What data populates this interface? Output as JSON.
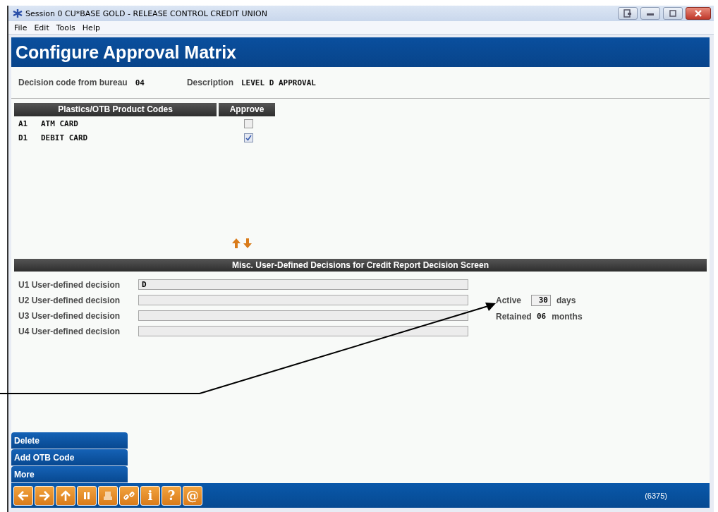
{
  "window": {
    "title": "Session 0 CU*BASE GOLD - RELEASE CONTROL CREDIT UNION"
  },
  "menu": [
    "File",
    "Edit",
    "Tools",
    "Help"
  ],
  "header": {
    "title": "Configure Approval Matrix"
  },
  "decision": {
    "label": "Decision code from bureau",
    "value": "04",
    "description_label": "Description",
    "description": "LEVEL D APPROVAL"
  },
  "products": {
    "columns": [
      "Plastics/OTB Product Codes",
      "Approve"
    ],
    "rows": [
      {
        "code": "A1",
        "name": "ATM CARD",
        "approve": false
      },
      {
        "code": "D1",
        "name": "DEBIT CARD",
        "approve": true
      }
    ]
  },
  "misc": {
    "title": "Misc. User-Defined Decisions for Credit Report Decision Screen",
    "decisions": [
      {
        "label": "U1 User-defined decision",
        "value": "D"
      },
      {
        "label": "U2 User-defined decision"
      },
      {
        "label": "U3 User-defined decision"
      },
      {
        "label": "U4 User-defined decision"
      }
    ],
    "active": {
      "label": "Active",
      "value": "30",
      "unit": "days"
    },
    "retained": {
      "label": "Retained",
      "value": "06",
      "unit": "months"
    }
  },
  "actions": [
    "Delete",
    "Add OTB Code",
    "More"
  ],
  "toolbar": {
    "buttons": [
      {
        "kind": "back"
      },
      {
        "kind": "forward"
      },
      {
        "kind": "up"
      },
      {
        "kind": "pause"
      },
      {
        "kind": "print"
      },
      {
        "kind": "link"
      },
      {
        "kind": "glyph",
        "glyph": "i"
      },
      {
        "kind": "glyph",
        "glyph": "?"
      },
      {
        "kind": "glyph",
        "glyph": "@"
      }
    ],
    "code": "(6375)"
  }
}
